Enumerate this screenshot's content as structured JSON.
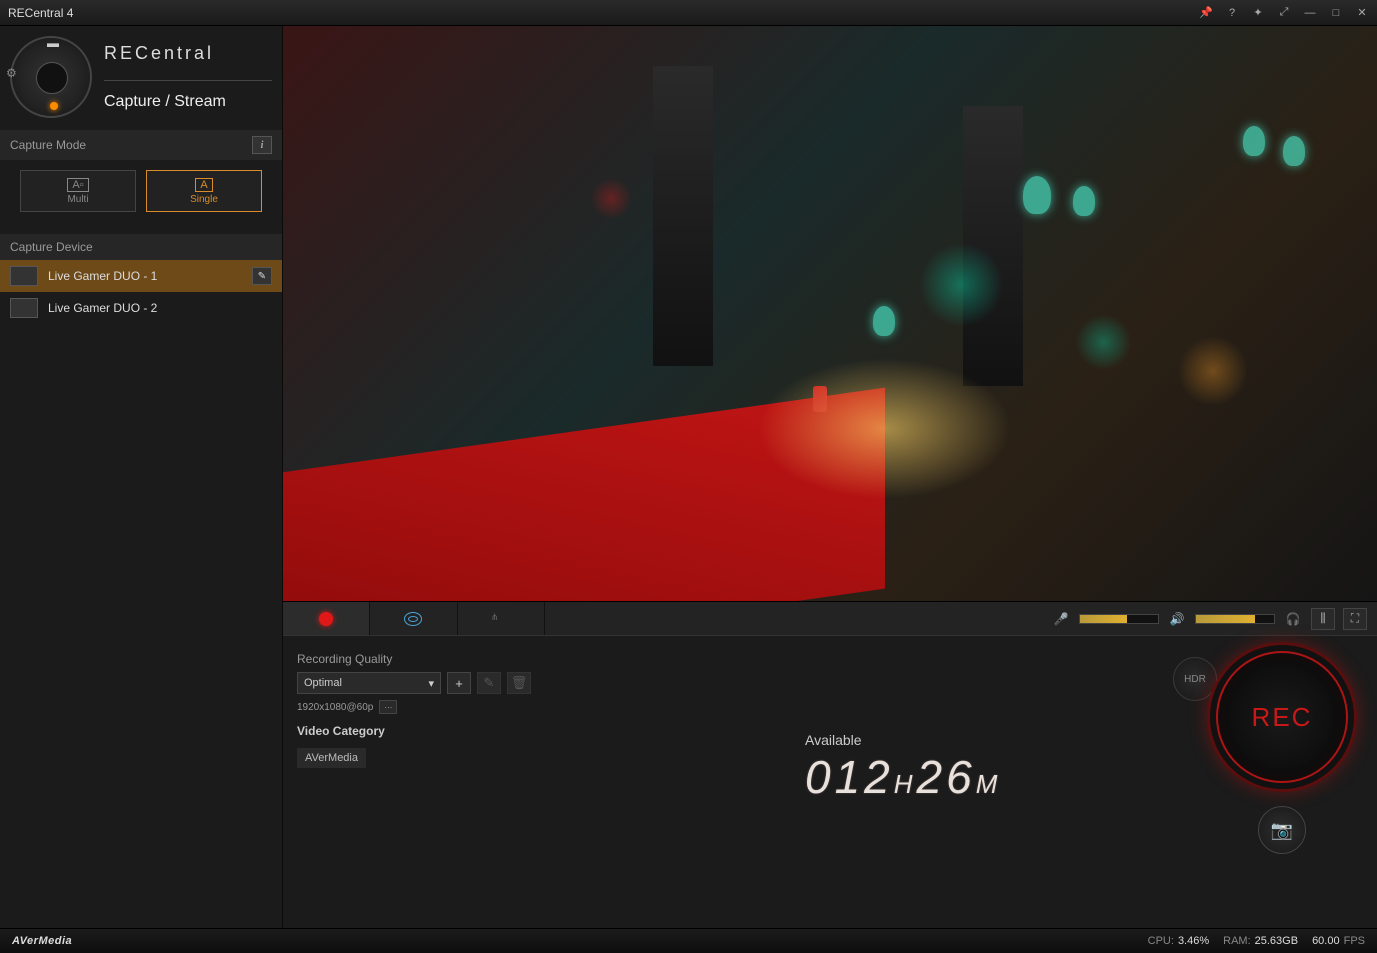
{
  "app": {
    "title": "RECentral 4"
  },
  "header": {
    "brand": "RECentral",
    "subtitle": "Capture / Stream"
  },
  "capture_mode": {
    "label": "Capture Mode",
    "multi": "Multi",
    "single": "Single"
  },
  "capture_device": {
    "label": "Capture Device",
    "items": [
      {
        "label": "Live Gamer DUO - 1",
        "selected": true
      },
      {
        "label": "Live Gamer DUO - 2",
        "selected": false
      }
    ]
  },
  "recording": {
    "quality_label": "Recording Quality",
    "quality_selected": "Optimal",
    "resolution": "1920x1080@60p",
    "category_label": "Video Category",
    "category_value": "AVerMedia"
  },
  "available": {
    "label": "Available",
    "hours": "012",
    "minutes": "26",
    "h_unit": "H",
    "m_unit": "M"
  },
  "buttons": {
    "hdr": "HDR",
    "rec": "REC"
  },
  "audio": {
    "mic_level": 60,
    "speaker_level": 75
  },
  "status": {
    "brand": "AVerMedia",
    "cpu_label": "CPU:",
    "cpu": "3.46%",
    "ram_label": "RAM:",
    "ram": "25.63GB",
    "fps": "60.00",
    "fps_label": "FPS"
  }
}
